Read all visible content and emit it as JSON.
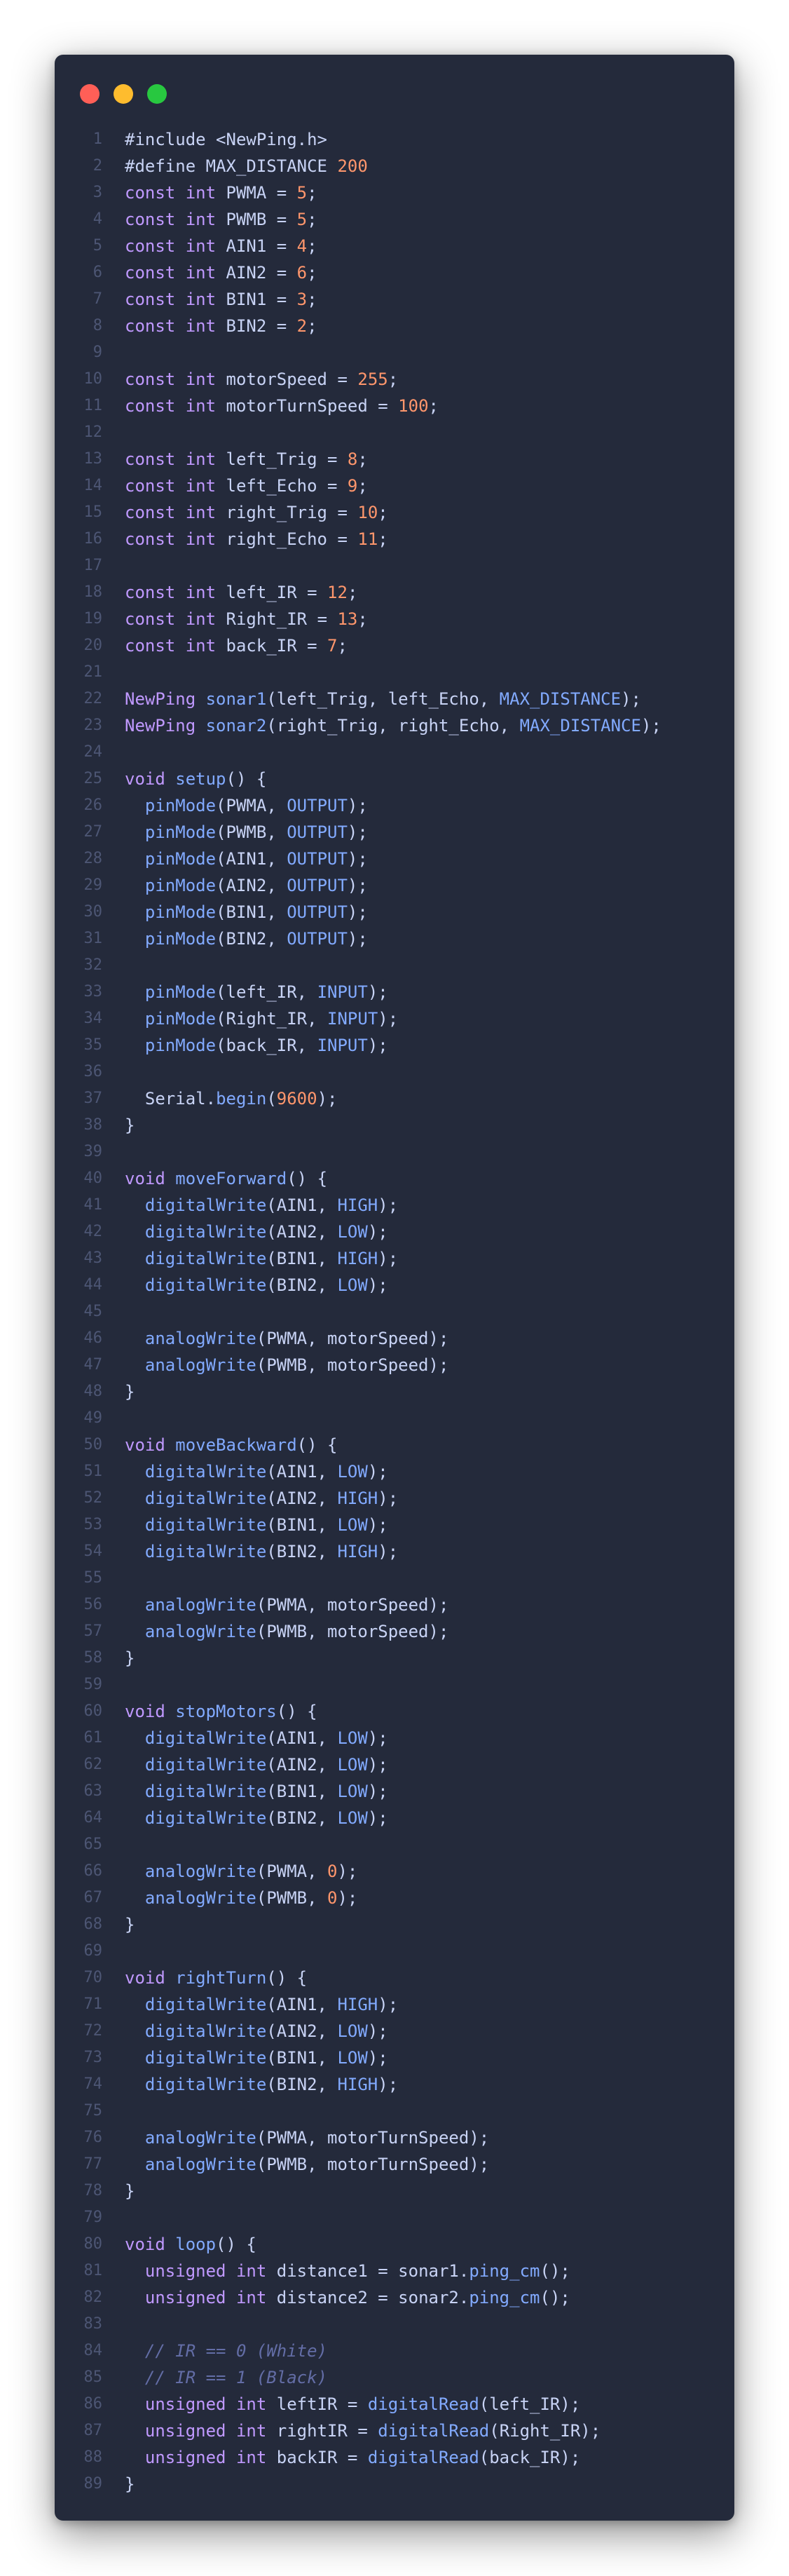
{
  "window_controls": [
    "close",
    "minimize",
    "maximize"
  ],
  "lines": [
    "#include <NewPing.h>",
    "#define MAX_DISTANCE 200",
    "const int PWMA = 5;",
    "const int PWMB = 5;",
    "const int AIN1 = 4;",
    "const int AIN2 = 6;",
    "const int BIN1 = 3;",
    "const int BIN2 = 2;",
    "",
    "const int motorSpeed = 255;",
    "const int motorTurnSpeed = 100;",
    "",
    "const int left_Trig = 8;",
    "const int left_Echo = 9;",
    "const int right_Trig = 10;",
    "const int right_Echo = 11;",
    "",
    "const int left_IR = 12;",
    "const int Right_IR = 13;",
    "const int back_IR = 7;",
    "",
    "NewPing sonar1(left_Trig, left_Echo, MAX_DISTANCE);",
    "NewPing sonar2(right_Trig, right_Echo, MAX_DISTANCE);",
    "",
    "void setup() {",
    "  pinMode(PWMA, OUTPUT);",
    "  pinMode(PWMB, OUTPUT);",
    "  pinMode(AIN1, OUTPUT);",
    "  pinMode(AIN2, OUTPUT);",
    "  pinMode(BIN1, OUTPUT);",
    "  pinMode(BIN2, OUTPUT);",
    "",
    "  pinMode(left_IR, INPUT);",
    "  pinMode(Right_IR, INPUT);",
    "  pinMode(back_IR, INPUT);",
    "",
    "  Serial.begin(9600);",
    "}",
    "",
    "void moveForward() {",
    "  digitalWrite(AIN1, HIGH);",
    "  digitalWrite(AIN2, LOW);",
    "  digitalWrite(BIN1, HIGH);",
    "  digitalWrite(BIN2, LOW);",
    "",
    "  analogWrite(PWMA, motorSpeed);",
    "  analogWrite(PWMB, motorSpeed);",
    "}",
    "",
    "void moveBackward() {",
    "  digitalWrite(AIN1, LOW);",
    "  digitalWrite(AIN2, HIGH);",
    "  digitalWrite(BIN1, LOW);",
    "  digitalWrite(BIN2, HIGH);",
    "",
    "  analogWrite(PWMA, motorSpeed);",
    "  analogWrite(PWMB, motorSpeed);",
    "}",
    "",
    "void stopMotors() {",
    "  digitalWrite(AIN1, LOW);",
    "  digitalWrite(AIN2, LOW);",
    "  digitalWrite(BIN1, LOW);",
    "  digitalWrite(BIN2, LOW);",
    "",
    "  analogWrite(PWMA, 0);",
    "  analogWrite(PWMB, 0);",
    "}",
    "",
    "void rightTurn() {",
    "  digitalWrite(AIN1, HIGH);",
    "  digitalWrite(AIN2, LOW);",
    "  digitalWrite(BIN1, LOW);",
    "  digitalWrite(BIN2, HIGH);",
    "",
    "  analogWrite(PWMA, motorTurnSpeed);",
    "  analogWrite(PWMB, motorTurnSpeed);",
    "}",
    "",
    "void loop() {",
    "  unsigned int distance1 = sonar1.ping_cm();",
    "  unsigned int distance2 = sonar2.ping_cm();",
    "",
    "  // IR == 0 (White)",
    "  // IR == 1 (Black)",
    "  unsigned int leftIR = digitalRead(left_IR);",
    "  unsigned int rightIR = digitalRead(Right_IR);",
    "  unsigned int backIR = digitalRead(back_IR);",
    "}"
  ]
}
